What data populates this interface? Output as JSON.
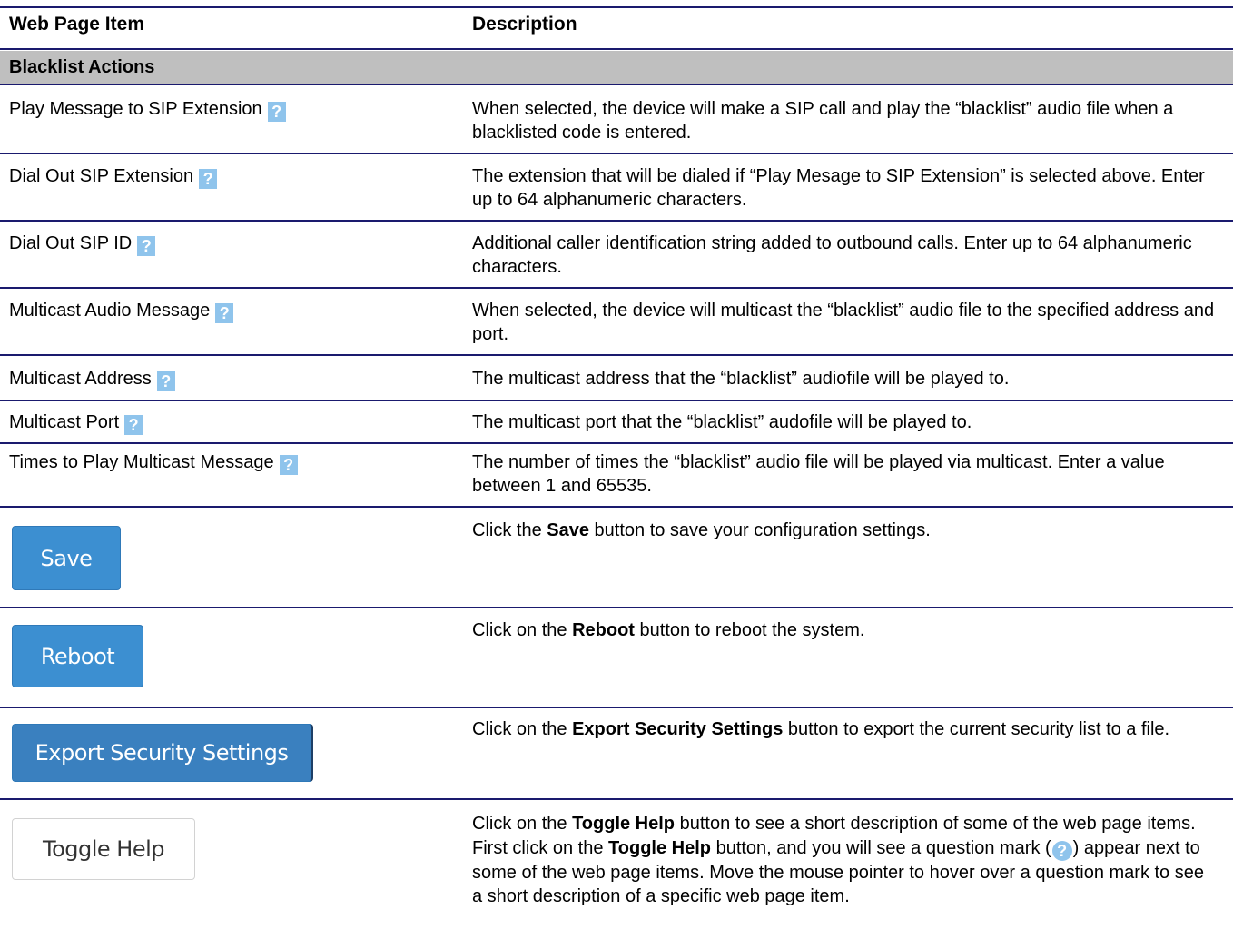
{
  "header": {
    "col1": "Web Page Item",
    "col2": "Description"
  },
  "section_title": "Blacklist Actions",
  "help_glyph": "?",
  "rows": [
    {
      "item": "Play Message to SIP Extension",
      "desc": "When selected, the device will make a SIP call and play the “blacklist” audio file when a blacklisted code is entered."
    },
    {
      "item": "Dial Out SIP Extension",
      "desc": "The extension that will be dialed if “Play Mesage to SIP Extension” is selected above. Enter up to 64 alphanumeric characters."
    },
    {
      "item": "Dial Out SIP ID",
      "desc": "Additional caller identification string added to outbound calls. Enter up to 64 alphanumeric characters."
    },
    {
      "item": "Multicast Audio Message",
      "desc": "When selected, the device will multicast the “blacklist” audio file to the specified address and port."
    },
    {
      "item": "Multicast Address",
      "desc": "The multicast address that the “blacklist” audiofile will be played to."
    },
    {
      "item": "Multicast Port",
      "desc": "The multicast port that the “blacklist” audofile will be played to."
    },
    {
      "item": "Times to Play Multicast Message",
      "desc": "The number of times the “blacklist” audio file will be played via multicast. Enter a value between 1 and 65535."
    }
  ],
  "buttons": {
    "save": {
      "label": "Save",
      "desc_pre": "Click the ",
      "desc_bold": "Save",
      "desc_post": " button to save your configuration settings."
    },
    "reboot": {
      "label": "Reboot",
      "desc_pre": "Click on the ",
      "desc_bold": "Reboot",
      "desc_post": " button to reboot the system."
    },
    "export": {
      "label": "Export Security Settings",
      "desc_pre": "Click on the ",
      "desc_bold": "Export Security Settings",
      "desc_post": " button to export the current security list to a file."
    },
    "toggle": {
      "label": "Toggle Help",
      "desc_pre": "Click on the ",
      "desc_bold": "Toggle Help",
      "desc_mid": " button to see a short description of some of the web page items. First click on the ",
      "desc_bold2": "Toggle Help",
      "desc_mid2": " button, and you will see a question mark (",
      "desc_post": ") appear next to some of the web page items. Move the mouse pointer to hover over a question mark to see a short description of a specific web page item."
    }
  },
  "colors": {
    "rule": "#1a1a6e",
    "section": "#bfbfbf",
    "button_blue": "#3c8fd1",
    "help_icon": "#8fc4ec"
  }
}
